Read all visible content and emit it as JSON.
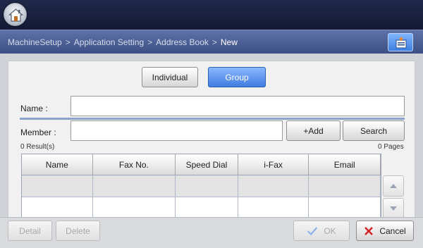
{
  "breadcrumb": {
    "items": [
      "MachineSetup",
      "Application Setting",
      "Address Book"
    ],
    "current": "New",
    "separator": ">"
  },
  "mode_tabs": {
    "individual": "Individual",
    "group": "Group",
    "selected": "Group"
  },
  "form": {
    "name_label": "Name :",
    "name_value": "",
    "member_label": "Member :",
    "member_value": "",
    "add_label": "+Add",
    "search_label": "Search"
  },
  "results": {
    "count_text": "0 Result(s)",
    "pages_text": "0 Pages"
  },
  "table": {
    "columns": [
      "Name",
      "Fax No.",
      "Speed Dial",
      "i-Fax",
      "Email"
    ],
    "rows": [
      [
        "",
        "",
        "",
        "",
        ""
      ],
      [
        "",
        "",
        "",
        "",
        ""
      ]
    ]
  },
  "footer": {
    "detail_label": "Detail",
    "delete_label": "Delete",
    "ok_label": "OK",
    "cancel_label": "Cancel"
  },
  "colors": {
    "accent": "#3f7ce0",
    "topbar": "#1a2140",
    "crumbbar": "#4a5f96",
    "cancel_icon": "#d42020",
    "ok_icon_disabled": "#8fb3e8"
  }
}
